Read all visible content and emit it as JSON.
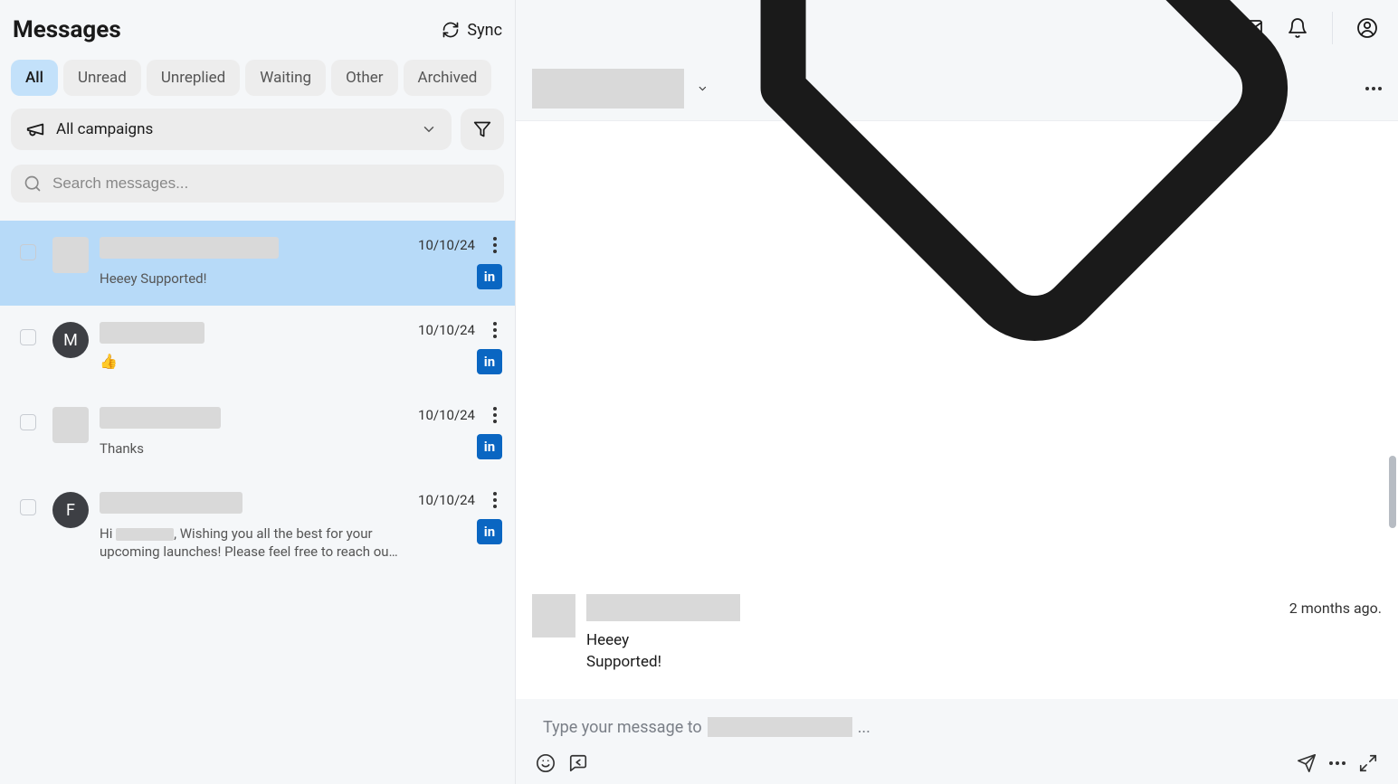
{
  "header": {
    "title": "Messages",
    "sync_label": "Sync"
  },
  "tabs": {
    "all": "All",
    "unread": "Unread",
    "unreplied": "Unreplied",
    "waiting": "Waiting",
    "other": "Other",
    "archived": "Archived"
  },
  "filters": {
    "campaign_label": "All campaigns"
  },
  "search": {
    "placeholder": "Search messages..."
  },
  "conversations": [
    {
      "date": "10/10/24",
      "preview": "Heeey Supported!",
      "source": "linkedin",
      "selected": true,
      "avatar_letter": "",
      "name_width": 198
    },
    {
      "date": "10/10/24",
      "preview_emoji": "👍",
      "source": "linkedin",
      "selected": false,
      "avatar_letter": "M",
      "name_width": 116
    },
    {
      "date": "10/10/24",
      "preview": "Thanks",
      "source": "linkedin",
      "selected": false,
      "avatar_letter": "",
      "name_width": 134
    },
    {
      "date": "10/10/24",
      "preview_prefix": "Hi ",
      "preview_suffix": ", Wishing you all the best for your upcoming launches! Please feel free to reach out if you need any...",
      "source": "linkedin",
      "selected": false,
      "avatar_letter": "F",
      "name_width": 158
    }
  ],
  "chat": {
    "time_label": "2 months ago.",
    "message_line1": "Heeey",
    "message_line2": "Supported!",
    "composer_prefix": "Type your message to ",
    "composer_suffix": "..."
  }
}
